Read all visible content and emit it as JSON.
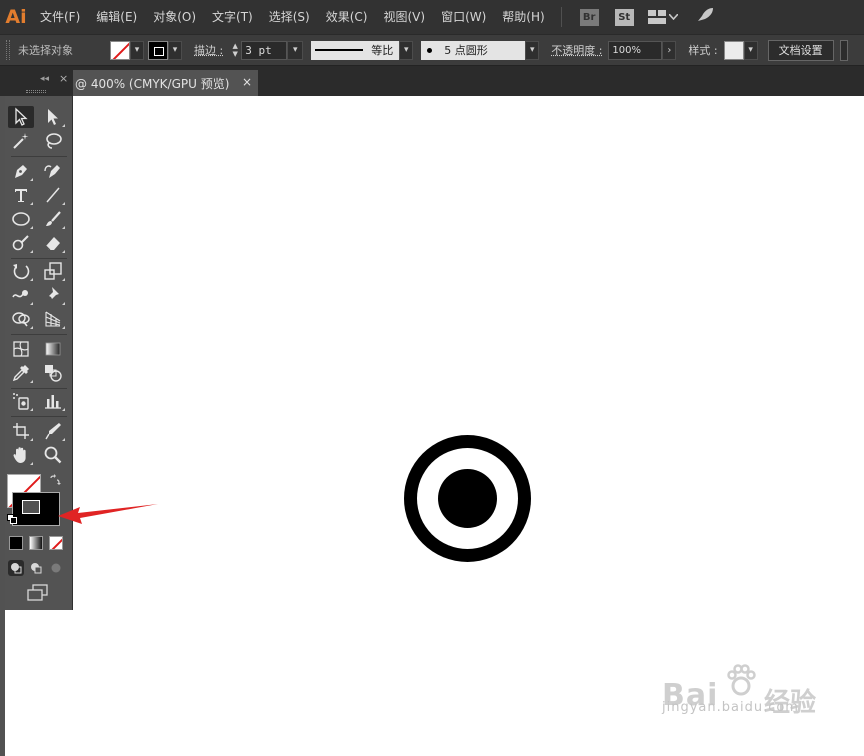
{
  "app": {
    "logo_text": "Ai",
    "menu": [
      "文件(F)",
      "编辑(E)",
      "对象(O)",
      "文字(T)",
      "选择(S)",
      "效果(C)",
      "视图(V)",
      "窗口(W)",
      "帮助(H)"
    ],
    "bridge_label": "Br",
    "stock_label": "St"
  },
  "control_bar": {
    "selection_status": "未选择对象",
    "stroke_label": "描边 :",
    "stroke_weight": "3 pt",
    "profile_label": "等比",
    "brush_label": "5 点圆形",
    "opacity_label": "不透明度 :",
    "opacity_value": "100%",
    "style_label": "样式 :",
    "doc_setup_label": "文档设置"
  },
  "document": {
    "tab_title": "@ 400% (CMYK/GPU 预览)",
    "close_glyph": "×"
  },
  "toolbox": {
    "close_glyph": "×",
    "collapse_glyph": "◂◂"
  },
  "colors": {
    "menubar_bg": "#323232",
    "controlbar_bg": "#3c3c3c",
    "panel_bg": "#535353",
    "ai_orange": "#e27d2e",
    "annotation_red": "#e02424",
    "none_red": "#e01b1b"
  },
  "watermark": {
    "brand": "Bai",
    "brand_cn": "经验",
    "url": "jingyan.baidu.com"
  }
}
